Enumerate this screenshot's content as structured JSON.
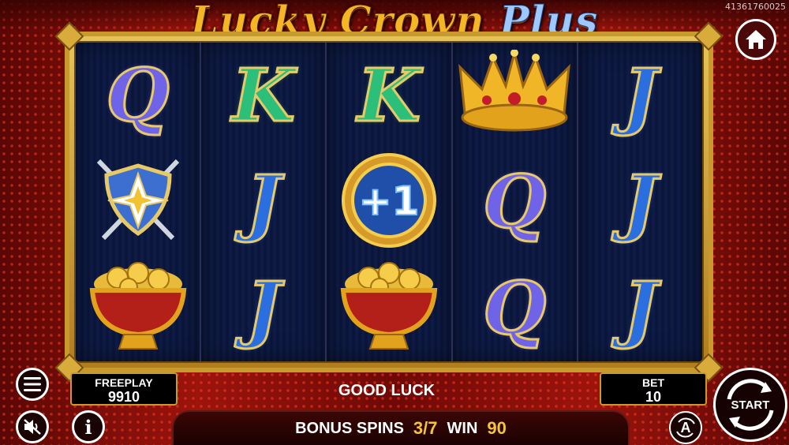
{
  "header": {
    "title_main": "Lucky Crown",
    "title_plus": "Plus",
    "game_id": "41361760025"
  },
  "reels": [
    [
      "Q",
      "shield",
      "pot"
    ],
    [
      "K",
      "J",
      "J"
    ],
    [
      "K",
      "plus1",
      "pot"
    ],
    [
      "crown",
      "Q",
      "Q"
    ],
    [
      "J",
      "J",
      "J"
    ]
  ],
  "plus1_label": "+1",
  "panel": {
    "freeplay_label": "FREEPLAY",
    "freeplay_value": "9910",
    "message": "GOOD LUCK",
    "bet_label": "BET",
    "bet_value": "10",
    "bonus_spins_label": "BONUS SPINS",
    "bonus_spins_value": "3/7",
    "win_label": "WIN",
    "win_value": "90",
    "start_label": "START",
    "auto_label": "A",
    "info_label": "i"
  },
  "colors": {
    "gold": "#f5c43a",
    "frame": "#c89a2e",
    "reel_bg": "#0a1436"
  }
}
